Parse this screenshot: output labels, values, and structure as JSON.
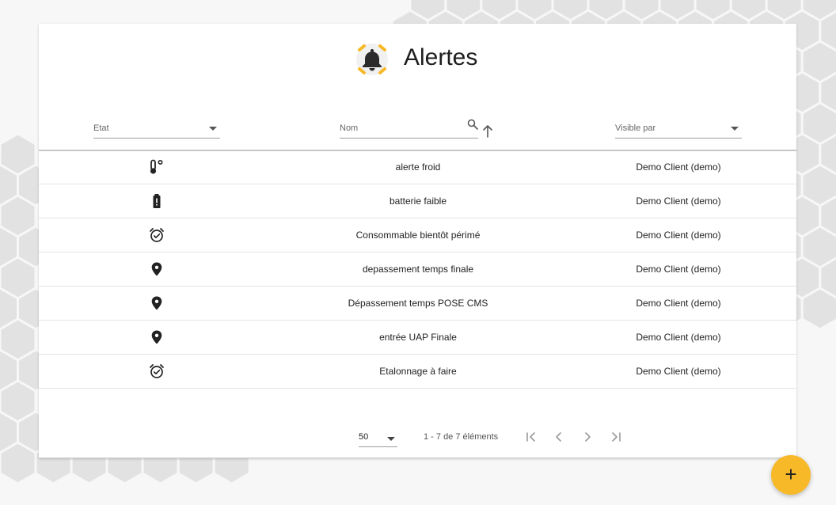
{
  "header": {
    "title": "Alertes",
    "logo_icon": "bell-icon",
    "accent_color": "#f7b928"
  },
  "filters": {
    "etat_label": "Etat",
    "nom_label": "Nom",
    "visible_label": "Visible par"
  },
  "rows": [
    {
      "icon": "thermometer-icon",
      "name": "alerte froid",
      "visible": "Demo Client (demo)"
    },
    {
      "icon": "battery-alert-icon",
      "name": "batterie faible",
      "visible": "Demo Client (demo)"
    },
    {
      "icon": "alarm-check-icon",
      "name": "Consommable bientôt périmé",
      "visible": "Demo Client (demo)"
    },
    {
      "icon": "location-pin-icon",
      "name": "depassement temps finale",
      "visible": "Demo Client (demo)"
    },
    {
      "icon": "location-pin-icon",
      "name": "Dépassement temps POSE CMS",
      "visible": "Demo Client (demo)"
    },
    {
      "icon": "location-pin-icon",
      "name": "entrée UAP Finale",
      "visible": "Demo Client (demo)"
    },
    {
      "icon": "alarm-check-icon",
      "name": "Etalonnage à faire",
      "visible": "Demo Client (demo)"
    }
  ],
  "pagination": {
    "per_page": "50",
    "range_text": "1 - 7 de 7 éléments"
  },
  "fab": {
    "label": "+"
  }
}
